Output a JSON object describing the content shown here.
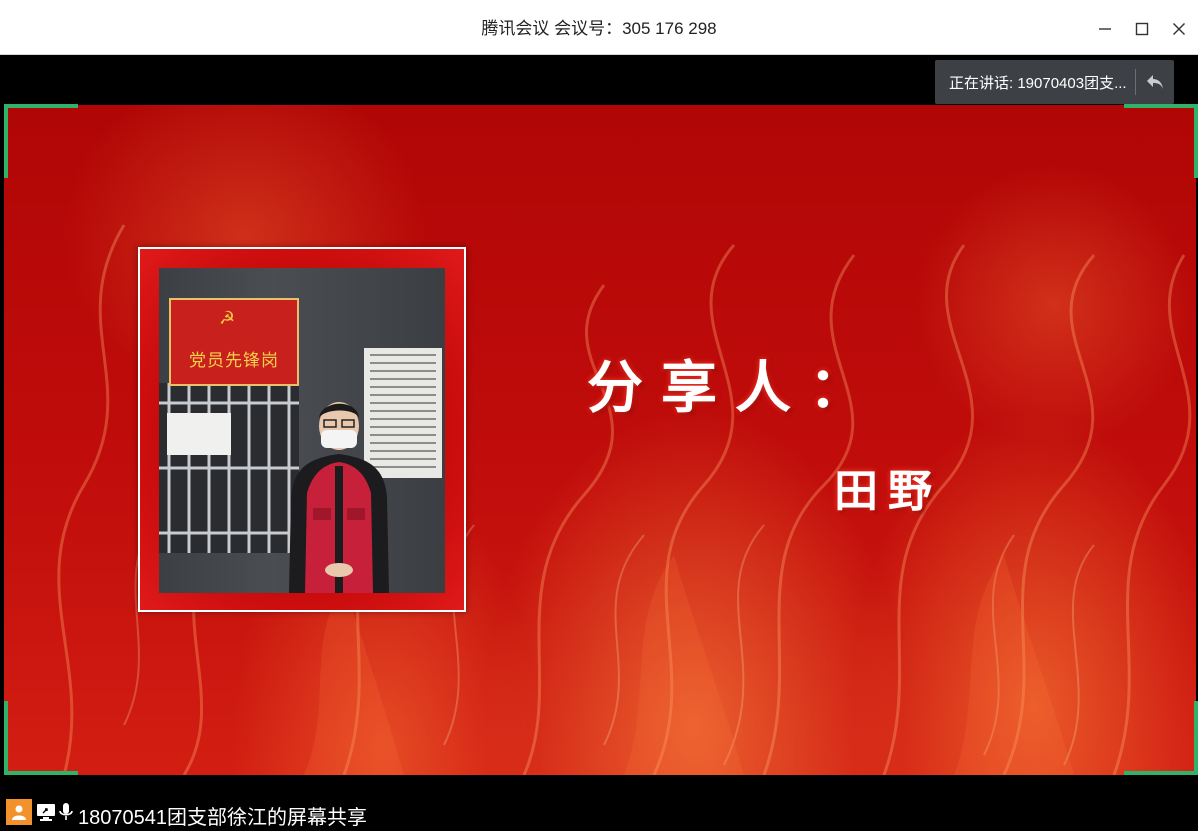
{
  "window": {
    "title": "腾讯会议 会议号：305 176 298",
    "minimize_icon": "minimize-icon",
    "maximize_icon": "maximize-icon",
    "close_icon": "close-icon"
  },
  "speaking_indicator": {
    "text": "正在讲话: 19070403团支...",
    "back_icon": "reply-arrow-icon"
  },
  "slide": {
    "title": "分享人：",
    "presenter": "田野",
    "photo": {
      "sign_text": "党员先锋岗",
      "emblem_icon": "party-emblem-icon"
    },
    "background_color": "#c10d0b",
    "accent_color": "#ff8a3c"
  },
  "share_frame": {
    "corner_color": "#2fb36a"
  },
  "bottom_bar": {
    "share_label": "18070541团支部徐江的屏幕共享",
    "user_icon": "user-avatar-icon",
    "screen_icon": "screen-share-icon",
    "mic_icon": "microphone-icon",
    "user_icon_color": "#f2922c"
  }
}
